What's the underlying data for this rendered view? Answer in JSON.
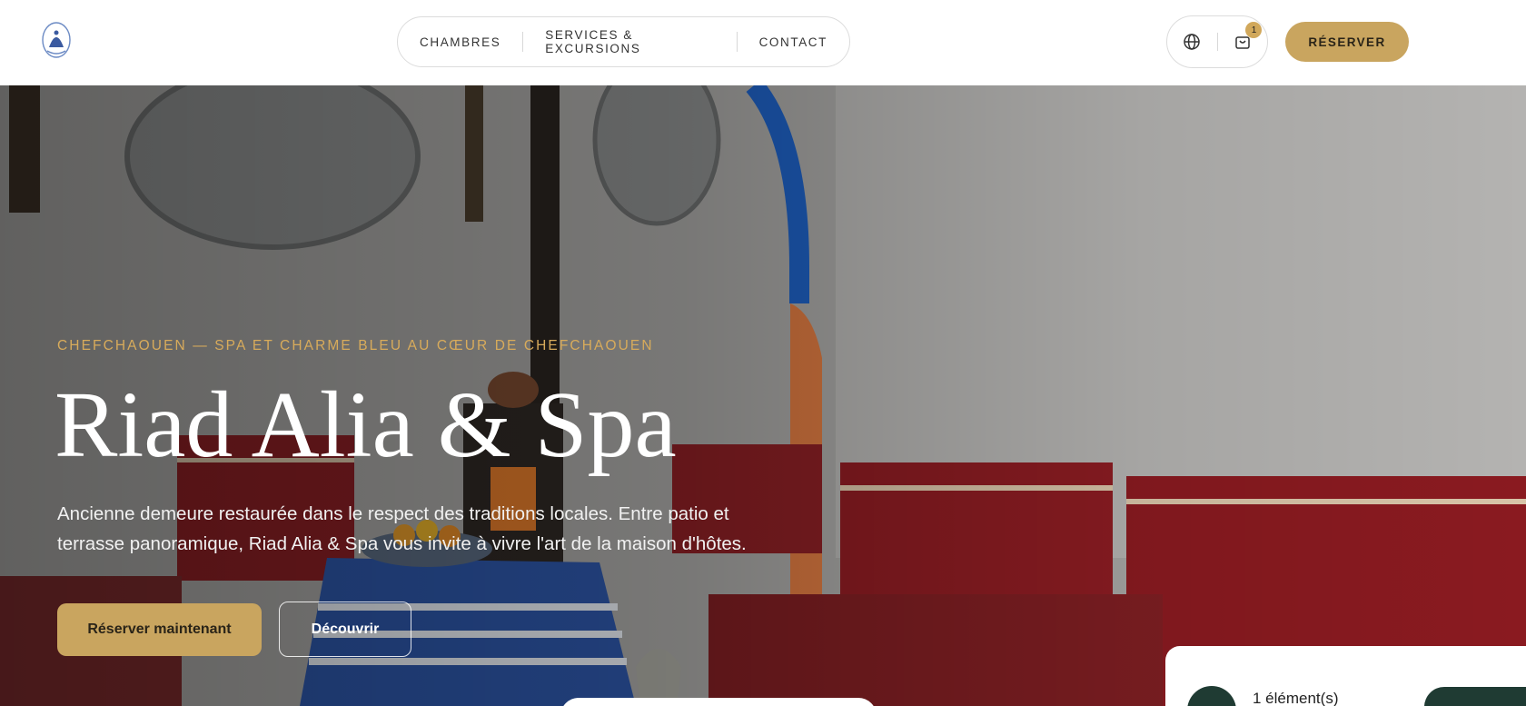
{
  "header": {
    "nav": [
      "CHAMBRES",
      "SERVICES & EXCURSIONS",
      "CONTACT"
    ],
    "cart_count": "1",
    "reserve_label": "RÉSERVER"
  },
  "hero": {
    "eyebrow": "CHEFCHAOUEN — SPA ET CHARME BLEU AU CŒUR DE CHEFCHAOUEN",
    "title": "Riad Alia & Spa",
    "description": "Ancienne demeure restaurée dans le respect des traditions locales. Entre patio et terrasse panoramique, Riad Alia & Spa vous invite à vivre l'art de la maison d'hôtes.",
    "primary_cta": "Réserver maintenant",
    "secondary_cta": "Découvrir"
  },
  "cart_panel": {
    "count_text": "1 élément(s)"
  },
  "colors": {
    "accent": "#c9a55f",
    "eyebrow": "#d8ab5b",
    "dark_green": "#1f3b33"
  },
  "icons": [
    "logo-emblem",
    "globe-icon",
    "shopping-bag-icon",
    "cart-bag-icon"
  ]
}
